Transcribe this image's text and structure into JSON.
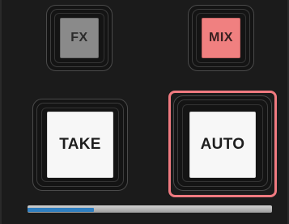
{
  "buttons": {
    "fx": {
      "label": "FX",
      "state": "inactive"
    },
    "mix": {
      "label": "MIX",
      "state": "active"
    },
    "take": {
      "label": "TAKE",
      "state": "inactive"
    },
    "auto": {
      "label": "AUTO",
      "state": "active"
    }
  },
  "transition_bar": {
    "progress": 0.27
  },
  "colors": {
    "background": "#1b1b1b",
    "fx_button": "#8a8a8a",
    "mix_button": "#f08080",
    "large_button": "#f7f7f7",
    "active_highlight": "#f07a80",
    "transition_fill": "#2f7fc1"
  }
}
